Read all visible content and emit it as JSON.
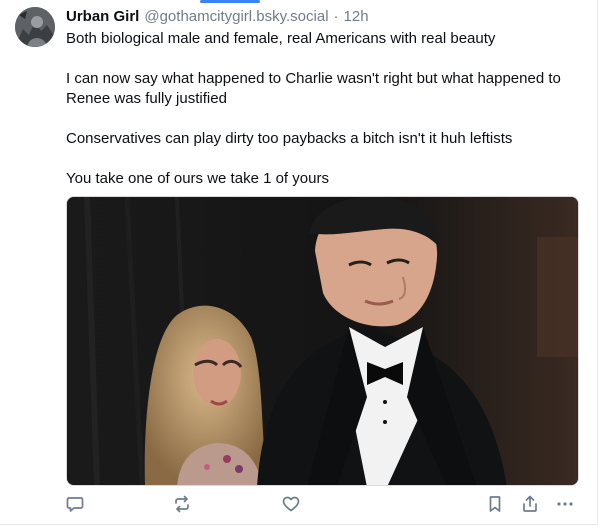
{
  "post": {
    "author": {
      "display_name": "Urban Girl",
      "handle": "@gothamcitygirl.bsky.social",
      "separator": "·",
      "time": "12h"
    },
    "text": {
      "line1": "Both biological male and female, real Americans with real beauty",
      "line2": "I can now say what happened to Charlie wasn't right but what happened to Renee was fully justified",
      "line3": "Conservatives can play dirty too paybacks a bitch isn't it huh leftists",
      "line4": "You take one of ours we take 1 of yours"
    },
    "image": {
      "description_icon": "photo"
    }
  },
  "actions": {
    "reply_icon": "reply-icon",
    "repost_icon": "repost-icon",
    "like_icon": "heart-icon",
    "bookmark_icon": "bookmark-icon",
    "share_icon": "share-icon",
    "more_icon": "more-icon"
  },
  "colors": {
    "accent": "#3b82f6",
    "icon": "#6f7c8b",
    "text": "#0b0f14",
    "muted": "#6f7c8b"
  }
}
